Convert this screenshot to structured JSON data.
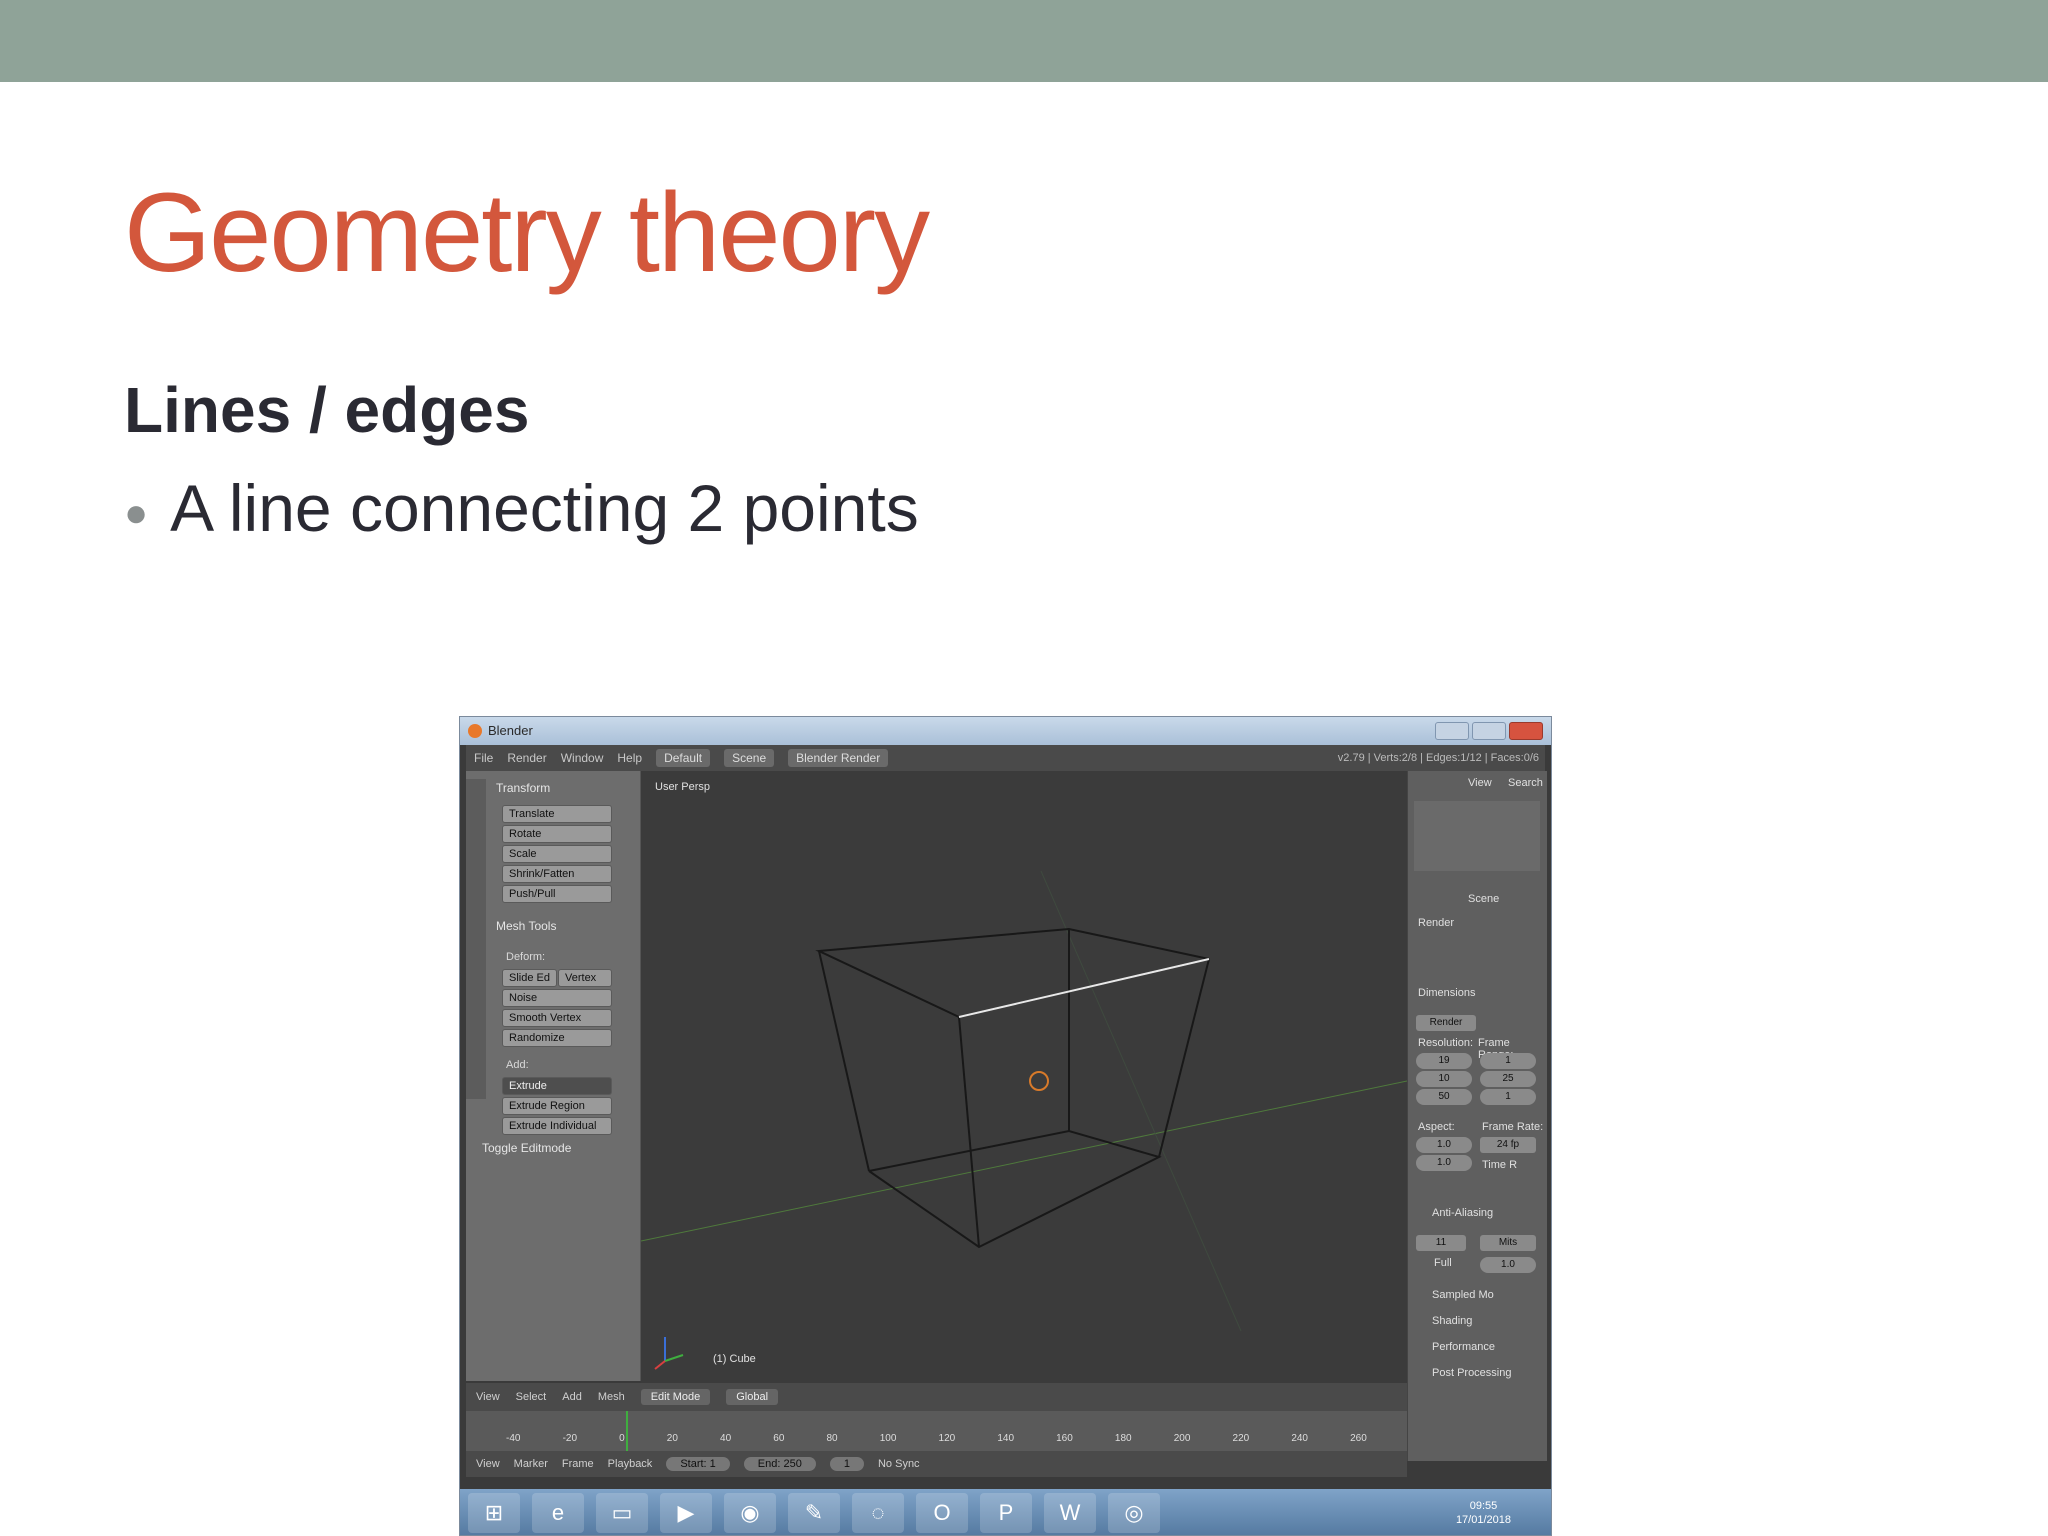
{
  "slide": {
    "title": "Geometry theory",
    "subheading": "Lines / edges",
    "bullet": "A line connecting 2 points"
  },
  "blender": {
    "window_title": "Blender",
    "menu": [
      "File",
      "Render",
      "Window",
      "Help"
    ],
    "layout": "Default",
    "scene": "Scene",
    "engine": "Blender Render",
    "stats": "v2.79 | Verts:2/8 | Edges:1/12 | Faces:0/6",
    "toolshelf": {
      "transform_header": "Transform",
      "transform_buttons": [
        "Translate",
        "Rotate",
        "Scale",
        "Shrink/Fatten",
        "Push/Pull"
      ],
      "mesh_tools_header": "Mesh Tools",
      "deform_label": "Deform:",
      "slide_edge": "Slide Ed",
      "vertex": "Vertex",
      "deform_buttons": [
        "Noise",
        "Smooth Vertex",
        "Randomize"
      ],
      "add_label": "Add:",
      "extrude": "Extrude",
      "add_buttons": [
        "Extrude Region",
        "Extrude Individual"
      ],
      "toggle": "Toggle Editmode"
    },
    "viewport": {
      "view_name": "User Persp",
      "object_name": "(1) Cube"
    },
    "properties": {
      "view": "View",
      "search": "Search",
      "scene": "Scene",
      "render": "Render",
      "dimensions": "Dimensions",
      "render_preset": "Render",
      "resolution": "Resolution:",
      "frame_range": "Frame Range:",
      "res_x": "19",
      "res_y": "10",
      "res_pct": "50",
      "frame_start": "1",
      "frame_end": "25",
      "frame_step": "1",
      "aspect": "Aspect:",
      "frame_rate": "Frame Rate:",
      "aspect_x": "1.0",
      "aspect_y": "1.0",
      "fps": "24 fp",
      "time_remap": "Time R",
      "anti_aliasing": "Anti-Aliasing",
      "aa_samples": "11",
      "aa_filter": "Mits",
      "full": "Full",
      "full_val": "1.0",
      "sampled": "Sampled Mo",
      "shading": "Shading",
      "performance": "Performance",
      "post": "Post Processing"
    },
    "header3d": {
      "items": [
        "View",
        "Select",
        "Add",
        "Mesh"
      ],
      "mode": "Edit Mode",
      "orientation": "Global"
    },
    "timeline": {
      "ticks": [
        "-40",
        "-20",
        "0",
        "20",
        "40",
        "60",
        "80",
        "100",
        "120",
        "140",
        "160",
        "180",
        "200",
        "220",
        "240",
        "260"
      ],
      "items": [
        "View",
        "Marker",
        "Frame",
        "Playback"
      ],
      "start_label": "Start:",
      "start": "1",
      "end_label": "End:",
      "end": "250",
      "current": "1",
      "sync": "No Sync"
    },
    "taskbar": {
      "time": "09:55",
      "date": "17/01/2018"
    }
  }
}
